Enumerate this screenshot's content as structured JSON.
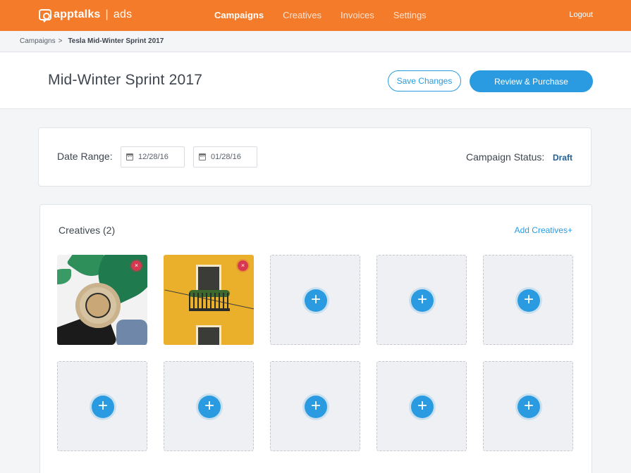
{
  "brand": {
    "name": "apptalks",
    "separator": "|",
    "product": "ads"
  },
  "nav": {
    "items": [
      {
        "label": "Campaigns",
        "active": true
      },
      {
        "label": "Creatives",
        "active": false
      },
      {
        "label": "Invoices",
        "active": false
      },
      {
        "label": "Settings",
        "active": false
      }
    ],
    "logout": "Logout"
  },
  "breadcrumb": {
    "parent": "Campaigns",
    "separator": ">",
    "current": "Tesla Mid-Winter Sprint 2017"
  },
  "header": {
    "title": "Mid-Winter Sprint 2017",
    "save_label": "Save Changes",
    "purchase_label": "Review & Purchase"
  },
  "date_range": {
    "label": "Date Range:",
    "start": "12/28/16",
    "end": "01/28/16",
    "status_label": "Campaign Status:",
    "status_value": "Draft"
  },
  "creatives": {
    "title": "Creatives (2)",
    "add_label": "Add Creatives+",
    "remove_symbol": "×",
    "add_symbol": "+",
    "images": [
      {
        "name": "beach-hat-image"
      },
      {
        "name": "yellow-building-image"
      }
    ],
    "empty_slots": 8
  },
  "colors": {
    "brand_orange": "#f47b2a",
    "accent_blue": "#2a9be0",
    "status_blue": "#1d5f96",
    "remove_red": "#d6384f"
  },
  "icons": [
    "apptalks-logo-icon",
    "calendar-icon",
    "remove-icon",
    "add-icon"
  ]
}
